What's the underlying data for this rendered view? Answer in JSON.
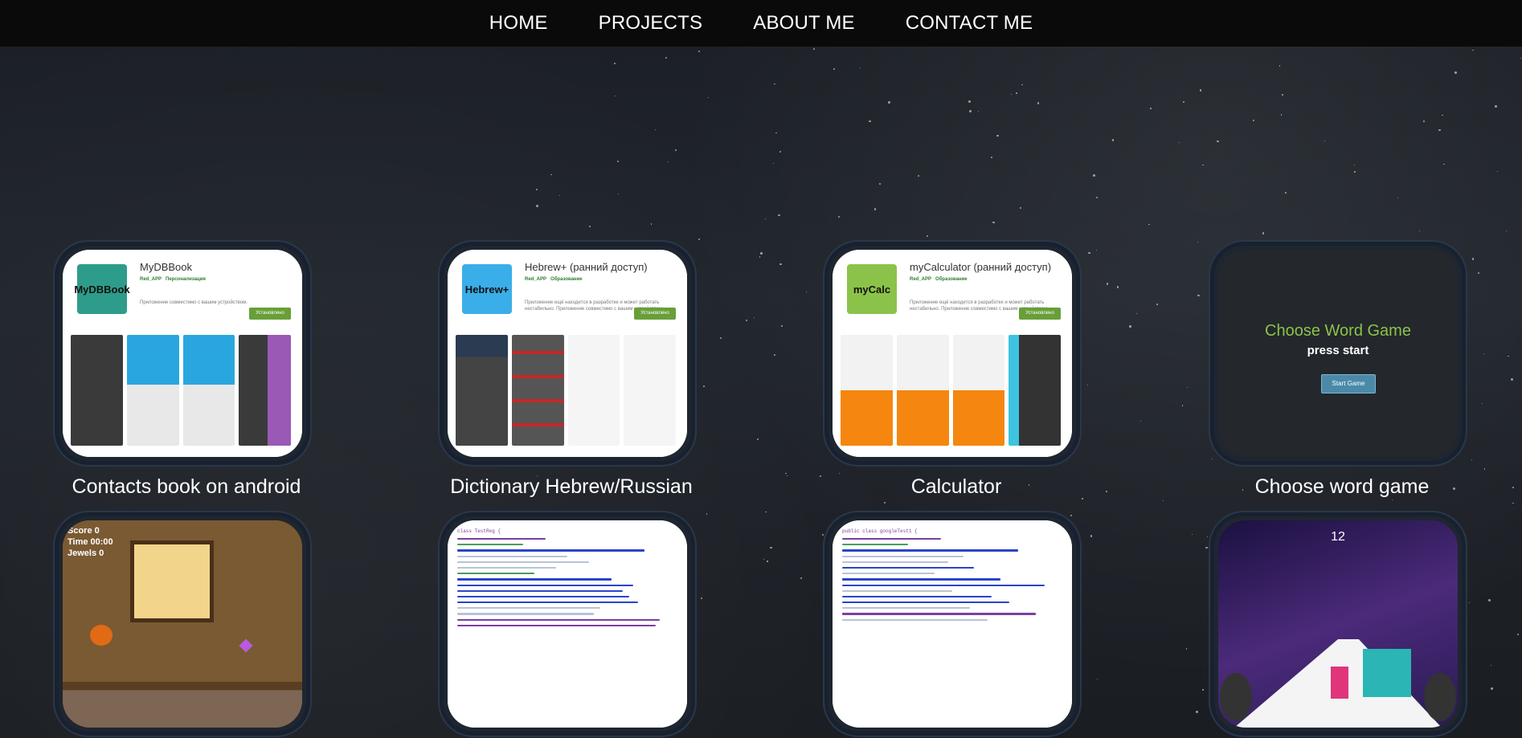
{
  "nav": {
    "items": [
      {
        "label": "HOME"
      },
      {
        "label": "PROJECTS"
      },
      {
        "label": "ABOUT ME"
      },
      {
        "label": "CONTACT ME"
      }
    ]
  },
  "projects": [
    {
      "caption": "Contacts book on android",
      "app_name": "MyDBBook",
      "icon_text": "MyDBBook",
      "developer": "Red_APP",
      "category": "Персонализация",
      "note": "Приложение совместимо с вашим устройством.",
      "install": "Установлено",
      "icon_color": "#2e9c8a"
    },
    {
      "caption": "Dictionary Hebrew/Russian",
      "app_name": "Hebrew+ (ранний доступ)",
      "icon_text": "Hebrew+",
      "developer": "Red_APP",
      "category": "Образование",
      "note": "Приложение ещё находится в разработке и может работать нестабильно. Приложение совместимо с вашим устройством.",
      "install": "Установлено",
      "icon_color": "#3aaee8"
    },
    {
      "caption": "Calculator",
      "app_name": "myCalculator (ранний доступ)",
      "icon_text": "myCalc",
      "developer": "Red_APP",
      "category": "Образование",
      "note": "Приложение ещё находится в разработке и может работать нестабильно. Приложение совместимо с вашим устройством.",
      "install": "Установлено",
      "icon_color": "#8bc34a"
    },
    {
      "caption": "Choose word game",
      "game_title": "Choose Word Game",
      "game_sub": "press start",
      "game_button": "Start Game"
    }
  ],
  "row2": [
    {
      "label": "Score 0",
      "label2": "Time 00:00",
      "label3": "Jewels 0"
    },
    {
      "code_head": "class TestReg {"
    },
    {
      "code_head": "public class googleTest1 {"
    },
    {
      "counter": "12"
    }
  ],
  "colors": {
    "nav_bg": "#0a0a0a",
    "card_border": "#2b3748",
    "install_green": "#689f38"
  }
}
